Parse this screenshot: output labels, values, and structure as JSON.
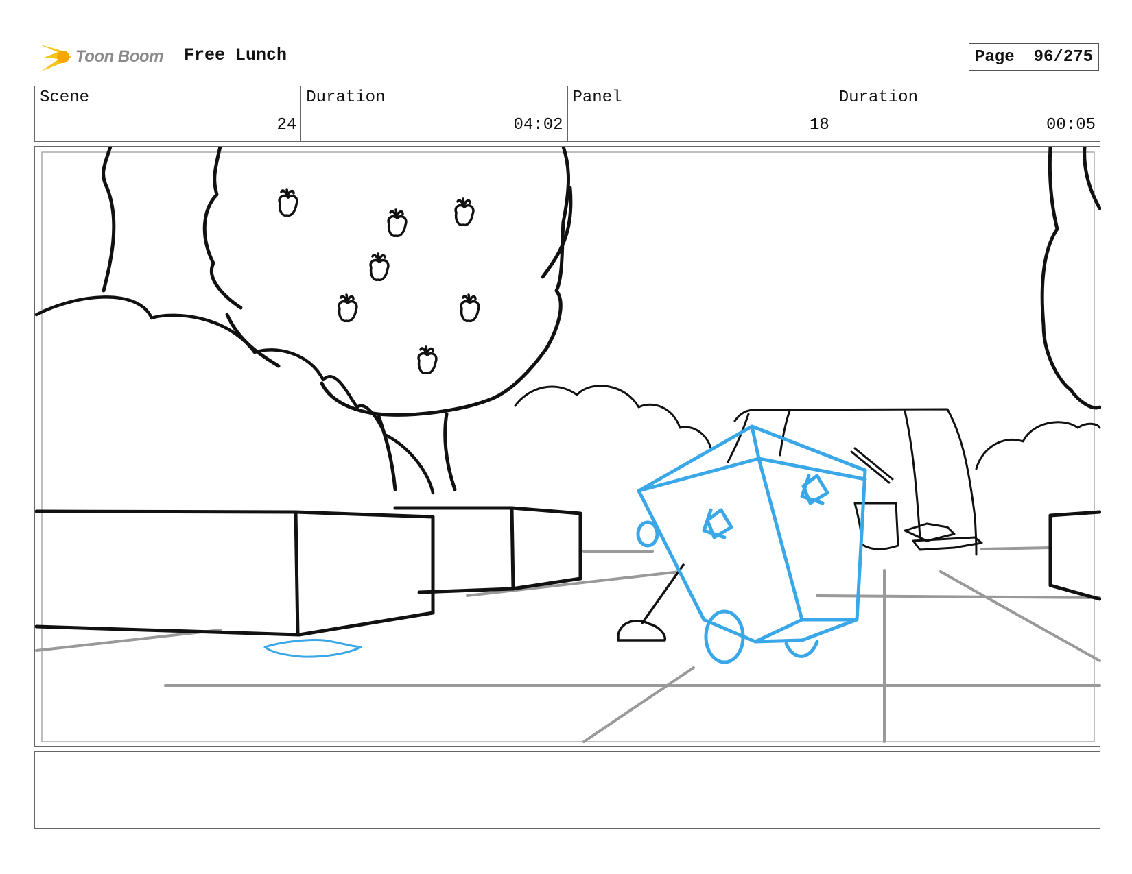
{
  "header": {
    "logo_text": "Toon Boom",
    "project_title": "Free Lunch",
    "page_label": "Page",
    "page_value": "96/275"
  },
  "info": {
    "scene_label": "Scene",
    "scene_value": "24",
    "scene_duration_label": "Duration",
    "scene_duration_value": "04:02",
    "panel_label": "Panel",
    "panel_value": "18",
    "panel_duration_label": "Duration",
    "panel_duration_value": "00:05"
  },
  "colors": {
    "ink": "#111111",
    "ground_lines": "#999999",
    "character_blue": "#3aa8e8",
    "logo_yellow": "#f5c518",
    "logo_gray": "#8a8a8a"
  },
  "notes": {
    "text": ""
  }
}
